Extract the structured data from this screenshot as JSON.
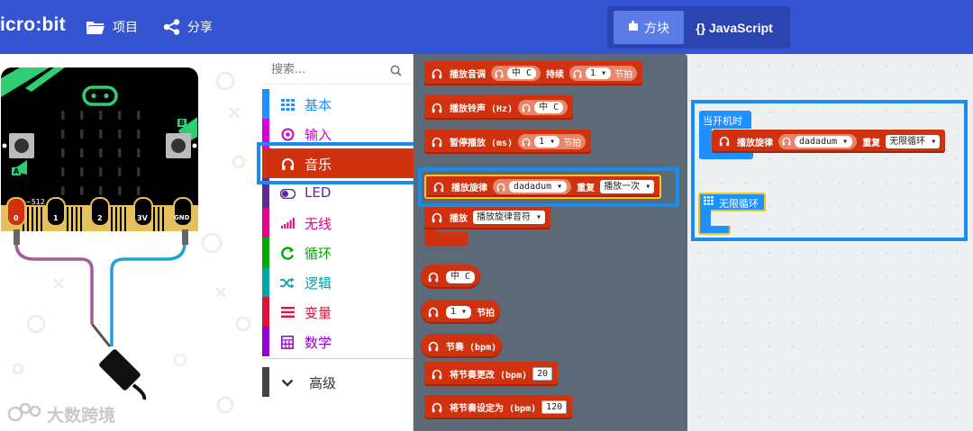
{
  "app": {
    "brand": "icro:bit",
    "nav": {
      "projects": "项目",
      "share": "分享"
    },
    "mode": {
      "blocks": "方块",
      "javascript": "{} JavaScript"
    }
  },
  "simulator": {
    "pins": [
      "0",
      "1",
      "2",
      "3V",
      "GND"
    ],
    "pin_value": "~512",
    "button_a": "A",
    "button_b": "B",
    "watermark": "大数跨境"
  },
  "toolbox": {
    "search_placeholder": "搜索...",
    "categories": [
      {
        "label": "基本",
        "color": "#1e90ff",
        "icon": "grid-icon"
      },
      {
        "label": "输入",
        "color": "#d400d4",
        "icon": "target-icon"
      },
      {
        "label": "音乐",
        "color": "#d0310e",
        "icon": "headphones-icon",
        "selected": true
      },
      {
        "label": "LED",
        "color": "#5c2d91",
        "icon": "toggle-icon"
      },
      {
        "label": "无线",
        "color": "#e3008c",
        "icon": "signal-icon"
      },
      {
        "label": "循环",
        "color": "#00aa00",
        "icon": "loop-icon"
      },
      {
        "label": "逻辑",
        "color": "#00a4a6",
        "icon": "shuffle-icon"
      },
      {
        "label": "变量",
        "color": "#dc143c",
        "icon": "list-icon"
      },
      {
        "label": "数学",
        "color": "#9400d3",
        "icon": "calculator-icon"
      }
    ],
    "advanced": "高级"
  },
  "flyout": {
    "play_tone": {
      "label": "播放音调",
      "note": "中 C",
      "for_label": "持续",
      "beat": "1 ▾",
      "beat_unit": "节拍"
    },
    "ring_tone": {
      "label": "播放铃声 (Hz)",
      "note": "中 C"
    },
    "rest": {
      "label": "暂停播放 (ms)",
      "beat": "1 ▾",
      "beat_unit": "节拍"
    },
    "start_melody": {
      "label": "播放旋律",
      "melody": "dadadum ▾",
      "repeat_label": "重复",
      "repeat": "播放一次 ▾"
    },
    "play_sound": {
      "label": "播放",
      "sound": "播放旋律音符 ▾"
    },
    "note_reporter": {
      "note": "中 C"
    },
    "beat_reporter": {
      "beat": "1 ▾",
      "unit": "节拍"
    },
    "tempo": {
      "label": "节奏 (bpm)"
    },
    "change_tempo": {
      "label": "将节奏更改 (bpm)",
      "value": "20"
    },
    "set_tempo": {
      "label": "将节奏设定为 (bpm)",
      "value": "120"
    }
  },
  "workspace": {
    "on_start": {
      "label": "当开机时",
      "melody_label": "播放旋律",
      "melody": "dadadum ▾",
      "repeat_label": "重复",
      "repeat": "无限循环 ▾"
    },
    "forever": {
      "label": "无限循环"
    }
  },
  "colors": {
    "topbar": "#3454d1",
    "music": "#d0310e",
    "highlight": "#1a8cf0",
    "flyout": "#5c6a78",
    "workspace": "#ecf0f1"
  }
}
